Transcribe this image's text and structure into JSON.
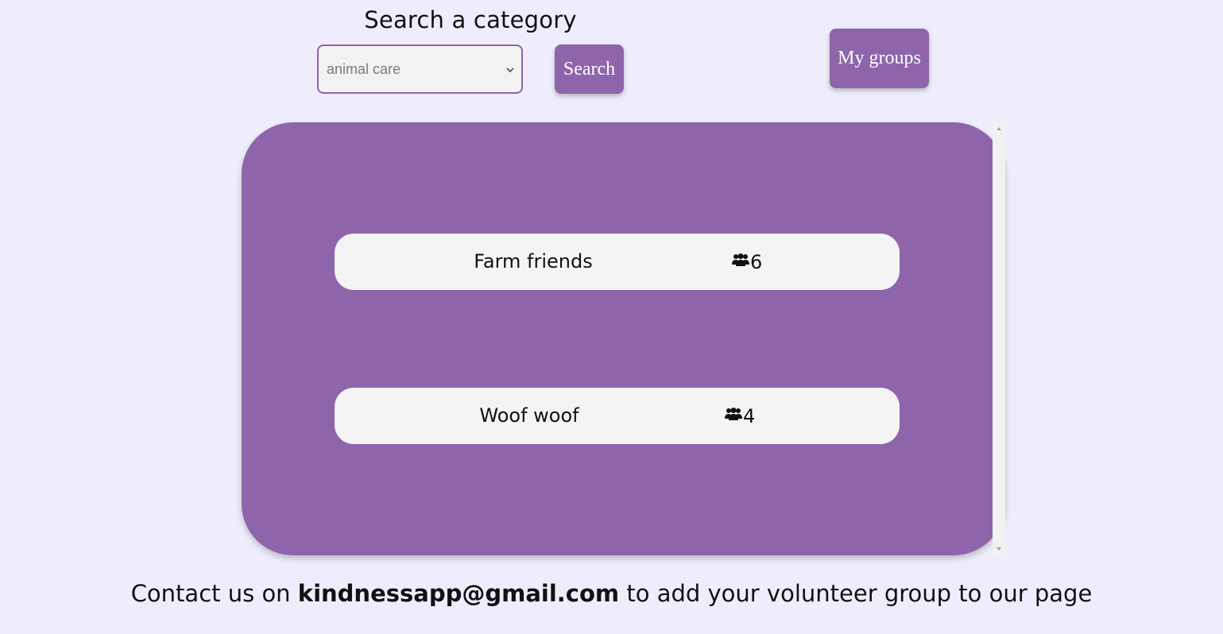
{
  "search": {
    "heading": "Search a category",
    "selected_category": "animal care",
    "button_label": "Search"
  },
  "header": {
    "my_groups_label": "My groups"
  },
  "groups": [
    {
      "name": "Farm friends",
      "members": "6",
      "icon": "people-icon"
    },
    {
      "name": "Woof woof",
      "members": "4",
      "icon": "people-icon"
    }
  ],
  "footer": {
    "prefix": "Contact us on ",
    "email": "kindnessapp@gmail.com",
    "suffix": " to add your volunteer group to our page"
  },
  "colors": {
    "accent": "#8e65ab",
    "background": "#efedfb",
    "card": "#f4f4f4"
  }
}
